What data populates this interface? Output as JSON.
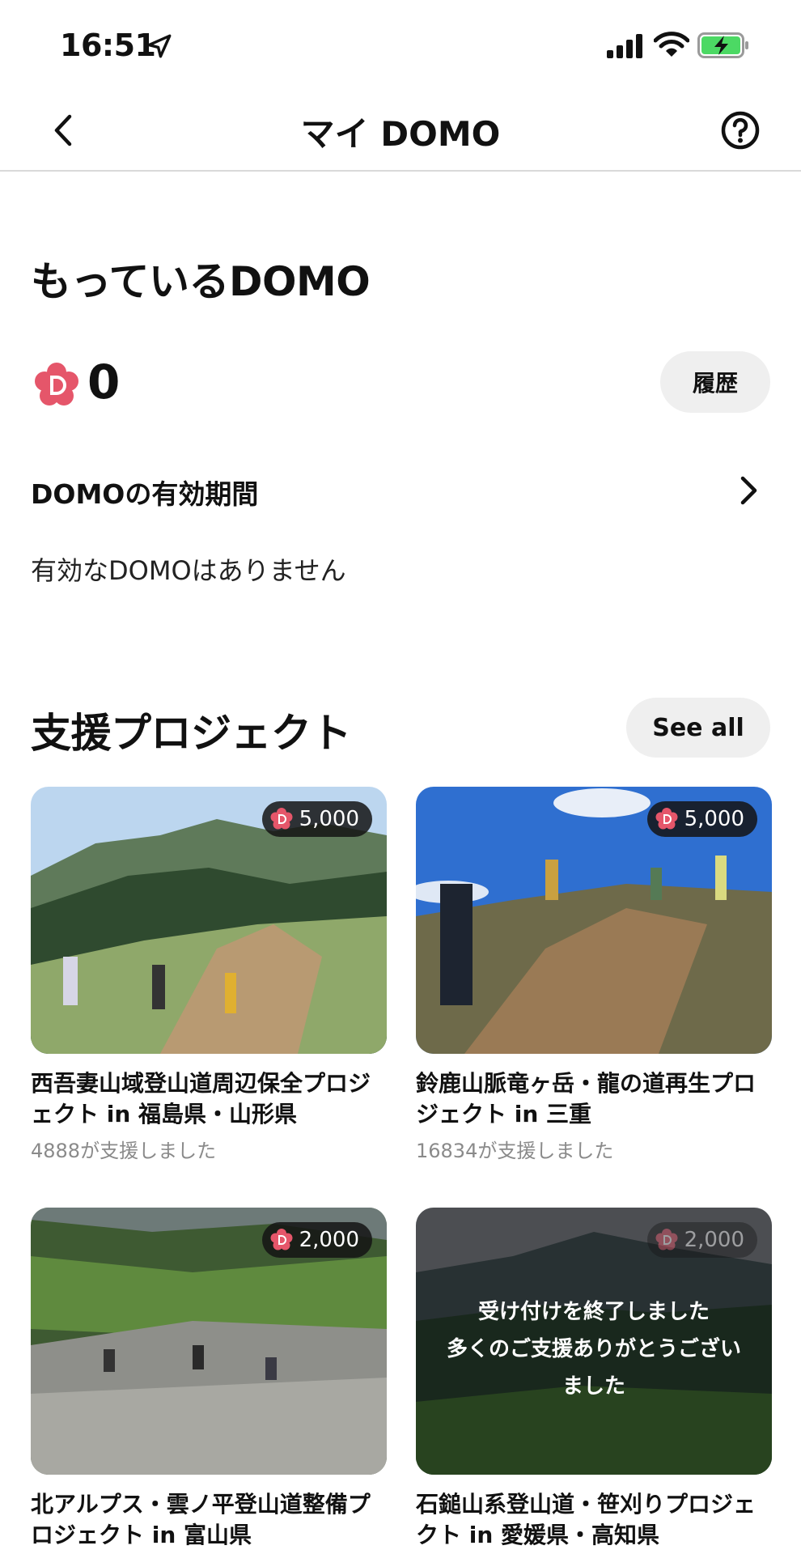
{
  "status_bar": {
    "time": "16:51"
  },
  "nav": {
    "title": "マイ DOMO"
  },
  "owned": {
    "title": "もっているDOMO",
    "balance": "0",
    "history_label": "履歴",
    "validity_label": "DOMOの有効期間",
    "validity_empty": "有効なDOMOはありません"
  },
  "projects": {
    "title": "支援プロジェクト",
    "see_all_label": "See all",
    "cards": [
      {
        "price": "5,000",
        "title": "西吾妻山域登山道周辺保全プロジェクト in 福島県・山形県",
        "supporters": "4888が支援しました"
      },
      {
        "price": "5,000",
        "title": "鈴鹿山脈竜ヶ岳・龍の道再生プロジェクト in 三重",
        "supporters": "16834が支援しました"
      },
      {
        "price": "2,000",
        "title": "北アルプス・雲ノ平登山道整備プロジェクト in 富山県",
        "supporters": ""
      },
      {
        "price": "2,000",
        "title": "石鎚山系登山道・笹刈りプロジェクト in 愛媛県・高知県",
        "supporters": "",
        "closed_lines": [
          "受け付けを終了しました",
          "多くのご支援ありがとうござい",
          "ました"
        ]
      }
    ]
  },
  "colors": {
    "accent": "#e5566a",
    "button_bg": "#efefef"
  },
  "icons": [
    "location-arrow-icon",
    "signal-icon",
    "wifi-icon",
    "battery-charging-icon",
    "back-icon",
    "help-icon",
    "domo-coin-icon",
    "chevron-right-icon"
  ]
}
